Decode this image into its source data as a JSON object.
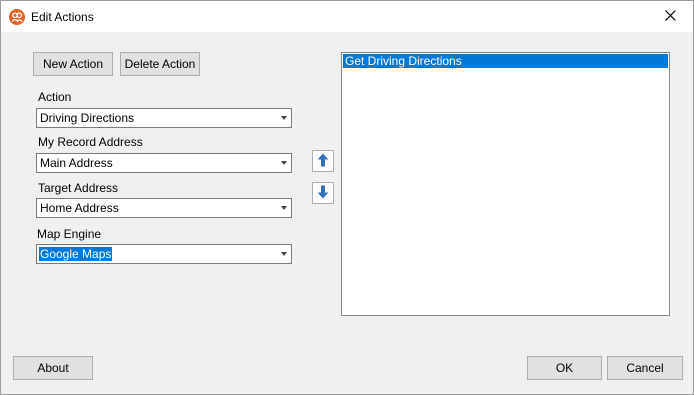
{
  "window": {
    "title": "Edit Actions"
  },
  "toolbar": {
    "new_action": "New Action",
    "delete_action": "Delete Action"
  },
  "fields": {
    "action": {
      "label": "Action",
      "value": "Driving Directions"
    },
    "my_record_address": {
      "label": "My Record Address",
      "value": "Main Address"
    },
    "target_address": {
      "label": "Target Address",
      "value": "Home Address"
    },
    "map_engine": {
      "label": "Map Engine",
      "value": "Google Maps"
    }
  },
  "actions_list": {
    "items": [
      "Get Driving Directions"
    ]
  },
  "footer": {
    "about": "About",
    "ok": "OK",
    "cancel": "Cancel"
  },
  "colors": {
    "accent": "#0078d7",
    "app_icon": "#e8641e"
  },
  "icons": {
    "app": "app-icon",
    "close": "close-icon",
    "up": "arrow-up-icon",
    "down": "arrow-down-icon"
  }
}
